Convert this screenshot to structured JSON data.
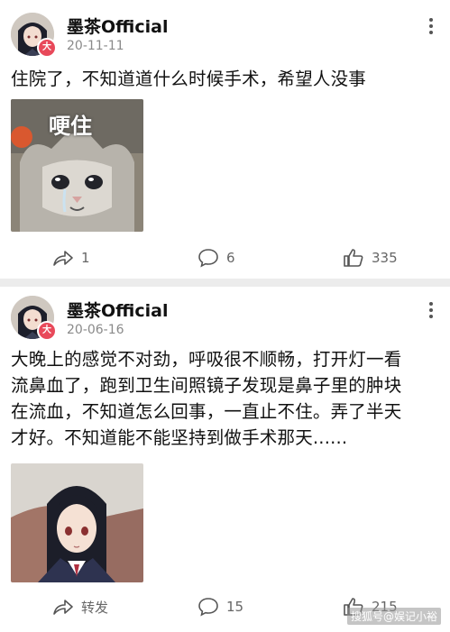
{
  "posts": [
    {
      "author": "墨茶Official",
      "avatar_badge": "大",
      "date": "20-11-11",
      "text": "住院了，不知道道什么时候手术，希望人没事",
      "image": {
        "kind": "crying-cat-meme",
        "caption": "哽住"
      },
      "actions": {
        "repost": "1",
        "comment": "6",
        "like": "335"
      }
    },
    {
      "author": "墨茶Official",
      "avatar_badge": "大",
      "date": "20-06-16",
      "text_lines": [
        "大晚上的感觉不对劲，呼吸很不顺畅，打开灯一看",
        "流鼻血了，跑到卫生间照镜子发现是鼻子里的肿块",
        "在流血，不知道怎么回事，一直止不住。弄了半天",
        "才好。不知道能不能坚持到做手术那天......"
      ],
      "image": {
        "kind": "anime-girl-portrait"
      },
      "actions": {
        "repost": "转发",
        "comment": "15",
        "like": "215"
      }
    }
  ],
  "watermark": "搜狐号@娱记小裕",
  "icons": {
    "repost": "repost-arrow-icon",
    "comment": "comment-bubble-icon",
    "like": "thumbs-up-icon",
    "more": "more-vertical-icon"
  },
  "colors": {
    "badge": "#e8495a",
    "meta": "#8a8a8a",
    "divider": "#ececec"
  }
}
